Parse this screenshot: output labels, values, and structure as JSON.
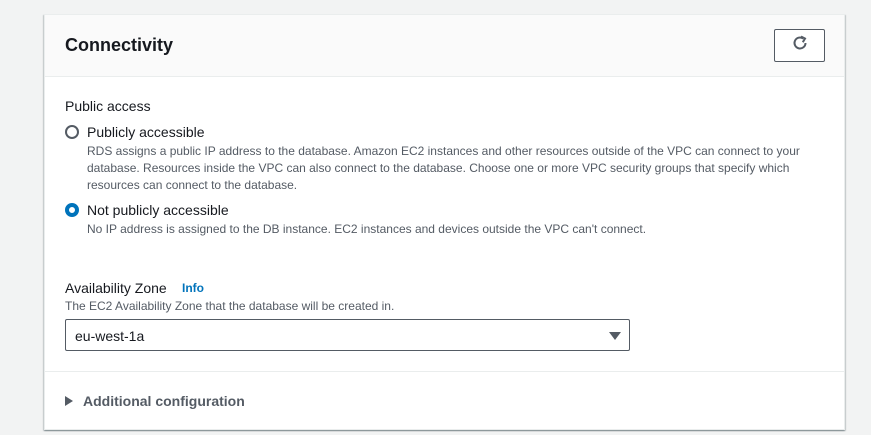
{
  "panel": {
    "title": "Connectivity",
    "refresh_icon": "refresh-icon"
  },
  "public_access": {
    "label": "Public access",
    "options": [
      {
        "label": "Publicly accessible",
        "selected": false,
        "description_lines": [
          "RDS assigns a public IP address to the database. Amazon EC2 instances and other resources outside of the VPC can connect to your",
          "database. Resources inside the VPC can also connect to the database. Choose one or more VPC security groups that specify which",
          "resources can connect to the database."
        ]
      },
      {
        "label": "Not publicly accessible",
        "selected": true,
        "description_lines": [
          "No IP address is assigned to the DB instance. EC2 instances and devices outside the VPC can't connect."
        ]
      }
    ]
  },
  "availability_zone": {
    "label": "Availability Zone",
    "info_link": "Info",
    "description": "The EC2 Availability Zone that the database will be created in.",
    "selected_value": "eu-west-1a"
  },
  "additional_configuration": {
    "label": "Additional configuration",
    "expanded": false
  },
  "colors": {
    "accent": "#0073bb",
    "text": "#16191f",
    "secondary_text": "#545b64",
    "border": "#eaeded"
  }
}
